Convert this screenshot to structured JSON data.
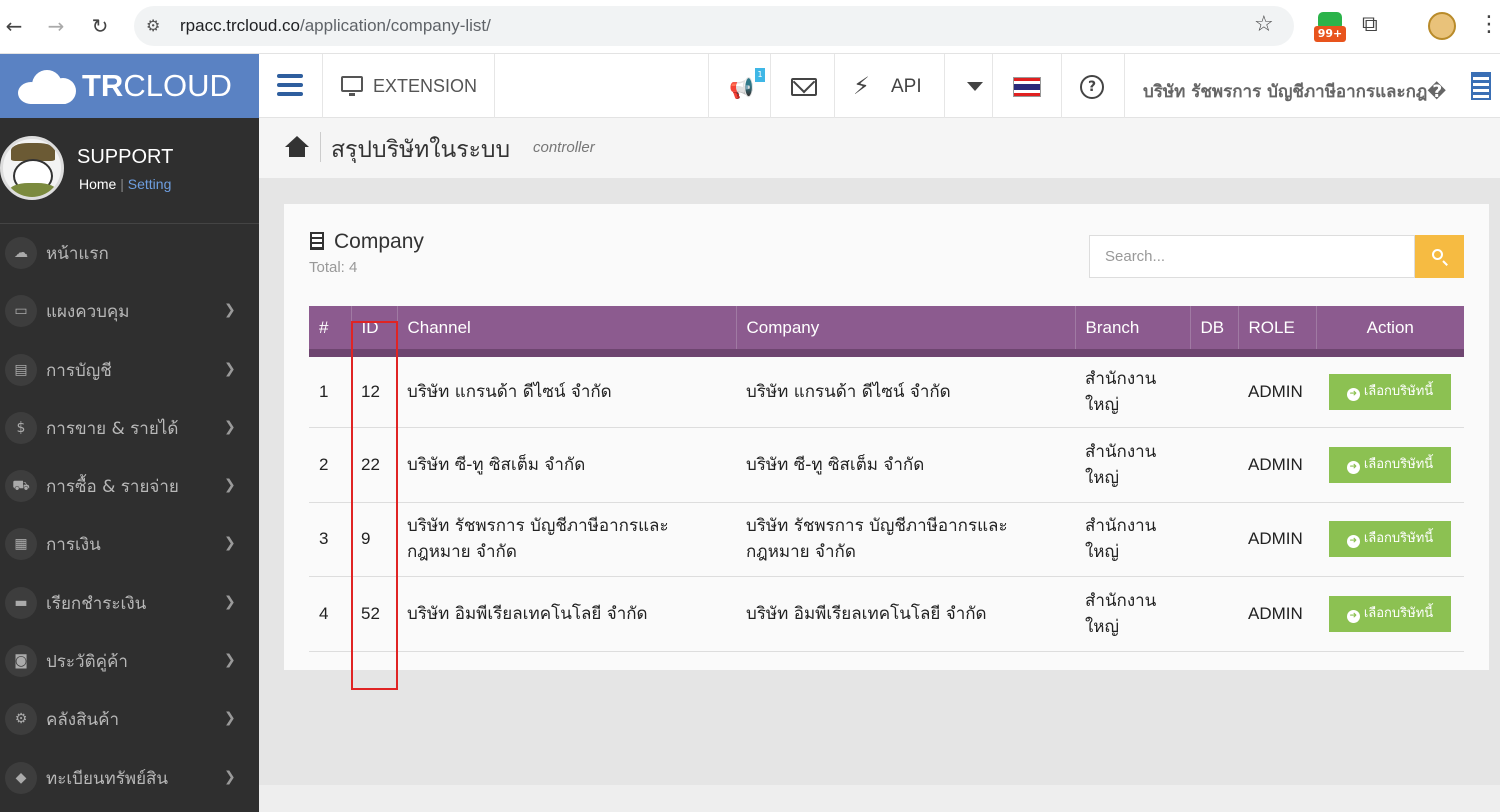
{
  "browser": {
    "url_host": "rpacc.trcloud.co",
    "url_path": "/application/company-list/",
    "ext_badge": "99+"
  },
  "sidebar": {
    "logo_bold": "TR",
    "logo_light": "CLOUD",
    "user_name": "SUPPORT",
    "link_home": "Home",
    "link_sep": "|",
    "link_setting": "Setting",
    "items": [
      {
        "label": "หน้าแรก",
        "icon": "☁",
        "has_children": false
      },
      {
        "label": "แผงควบคุม",
        "icon": "▭",
        "has_children": true
      },
      {
        "label": "การบัญชี",
        "icon": "▤",
        "has_children": true
      },
      {
        "label": "การขาย & รายได้",
        "icon": "$",
        "has_children": true
      },
      {
        "label": "การซื้อ & รายจ่าย",
        "icon": "⛟",
        "has_children": true
      },
      {
        "label": "การเงิน",
        "icon": "▦",
        "has_children": true
      },
      {
        "label": "เรียกชำระเงิน",
        "icon": "▬",
        "has_children": true
      },
      {
        "label": "ประวัติคู่ค้า",
        "icon": "◙",
        "has_children": true
      },
      {
        "label": "คลังสินค้า",
        "icon": "⚙",
        "has_children": true
      },
      {
        "label": "ทะเบียนทรัพย์สิน",
        "icon": "◆",
        "has_children": true
      }
    ]
  },
  "topnav": {
    "extension_label": "EXTENSION",
    "notif_badge": "1",
    "api_label": "API",
    "company_name": "บริษัท รัชพรการ บัญชีภาษีอากรและกฎ�"
  },
  "page": {
    "title": "สรุปบริษัทในระบบ",
    "subtitle": "controller"
  },
  "panel": {
    "title": "Company",
    "total_label": "Total:",
    "total_value": "4",
    "search_placeholder": "Search..."
  },
  "table": {
    "headers": [
      "#",
      "ID",
      "Channel",
      "Company",
      "Branch",
      "DB",
      "ROLE",
      "Action"
    ],
    "rows": [
      {
        "no": "1",
        "id": "12",
        "channel": "บริษัท แกรนด้า ดีไซน์ จำกัด",
        "company": "บริษัท แกรนด้า ดีไซน์ จำกัด",
        "branch": "สำนักงาน ใหญ่",
        "db": "",
        "role": "ADMIN",
        "action": "เลือกบริษัทนี้"
      },
      {
        "no": "2",
        "id": "22",
        "channel": "บริษัท ซี-ทู ซิสเต็ม จำกัด",
        "company": "บริษัท ซี-ทู ซิสเต็ม จำกัด",
        "branch": "สำนักงาน ใหญ่",
        "db": "",
        "role": "ADMIN",
        "action": "เลือกบริษัทนี้"
      },
      {
        "no": "3",
        "id": "9",
        "channel": "บริษัท รัชพรการ บัญชีภาษีอากรและกฎหมาย จำกัด",
        "company": "บริษัท รัชพรการ บัญชีภาษีอากรและกฎหมาย จำกัด",
        "branch": "สำนักงาน ใหญ่",
        "db": "",
        "role": "ADMIN",
        "action": "เลือกบริษัทนี้"
      },
      {
        "no": "4",
        "id": "52",
        "channel": "บริษัท อิมพีเรียลเทคโนโลยี จำกัด",
        "company": "บริษัท อิมพีเรียลเทคโนโลยี จำกัด",
        "branch": "สำนักงาน ใหญ่",
        "db": "",
        "role": "ADMIN",
        "action": "เลือกบริษัทนี้"
      }
    ]
  },
  "colors": {
    "sidebar_bg": "#2f2f2f",
    "logo_bg": "#5a82c3",
    "table_header": "#8c5b8f",
    "select_button": "#8cc152",
    "search_button": "#f6bb42",
    "highlight_box": "#e02424"
  }
}
